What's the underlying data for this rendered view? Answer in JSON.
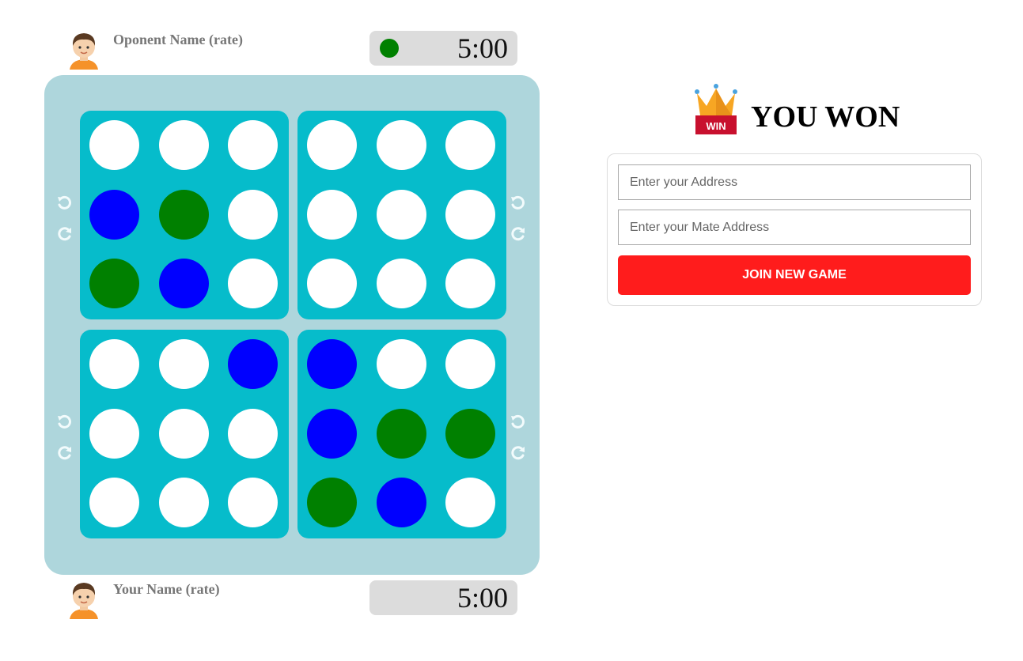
{
  "colors": {
    "board": "#aed6dc",
    "quadrant": "#06bccb",
    "empty": "#ffffff",
    "blue": "#0000ff",
    "green": "#008000",
    "rotate_icon": "#f2fbfc",
    "button": "#ff1c1c"
  },
  "opponent": {
    "name": "Oponent Name (rate)",
    "timer": "5:00",
    "turn_indicator_color": "#008000",
    "avatar_icon": "boy-avatar-icon"
  },
  "player": {
    "name": "Your Name (rate)",
    "timer": "5:00",
    "avatar_icon": "boy-avatar-icon"
  },
  "board": {
    "quadrants": [
      {
        "label": "top-left",
        "cells": [
          [
            "empty",
            "empty",
            "empty"
          ],
          [
            "blue",
            "green",
            "empty"
          ],
          [
            "green",
            "blue",
            "empty"
          ]
        ]
      },
      {
        "label": "top-right",
        "cells": [
          [
            "empty",
            "empty",
            "empty"
          ],
          [
            "empty",
            "empty",
            "empty"
          ],
          [
            "empty",
            "empty",
            "empty"
          ]
        ]
      },
      {
        "label": "bottom-left",
        "cells": [
          [
            "empty",
            "empty",
            "blue"
          ],
          [
            "empty",
            "empty",
            "empty"
          ],
          [
            "empty",
            "empty",
            "empty"
          ]
        ]
      },
      {
        "label": "bottom-right",
        "cells": [
          [
            "blue",
            "empty",
            "empty"
          ],
          [
            "blue",
            "green",
            "green"
          ],
          [
            "green",
            "blue",
            "empty"
          ]
        ]
      }
    ],
    "rotate_icons": [
      "rotate-counterclockwise-icon",
      "rotate-clockwise-icon"
    ]
  },
  "result": {
    "badge_icon": "crown-win-icon",
    "badge_text": "WIN",
    "text": "YOU WON"
  },
  "form": {
    "address_placeholder": "Enter your Address",
    "mate_address_placeholder": "Enter your Mate Address",
    "join_label": "JOIN NEW GAME"
  }
}
